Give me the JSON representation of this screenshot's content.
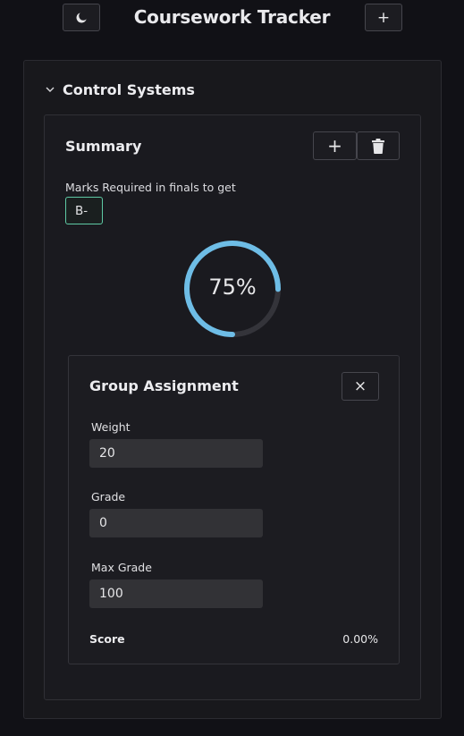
{
  "header": {
    "title": "Coursework Tracker",
    "theme_icon": "moon-icon",
    "add_label": "+"
  },
  "course": {
    "name": "Control Systems",
    "expanded": true,
    "summary": {
      "title": "Summary",
      "add_label": "+",
      "delete_icon": "trash-icon",
      "marks_required_label": "Marks Required in finals to get",
      "target_grade": "B-",
      "progress_text": "75%",
      "progress_fraction": 0.75,
      "progress_color": "#6ebde6",
      "track_color": "#34343a"
    },
    "assignment": {
      "title": "Group Assignment",
      "close_label": "×",
      "fields": [
        {
          "label": "Weight",
          "value": "20"
        },
        {
          "label": "Grade",
          "value": "0"
        },
        {
          "label": "Max Grade",
          "value": "100"
        }
      ],
      "score_label": "Score",
      "score_value": "0.00%"
    }
  },
  "colors": {
    "background": "#111116",
    "accent_select_border": "#5ec9a4"
  }
}
